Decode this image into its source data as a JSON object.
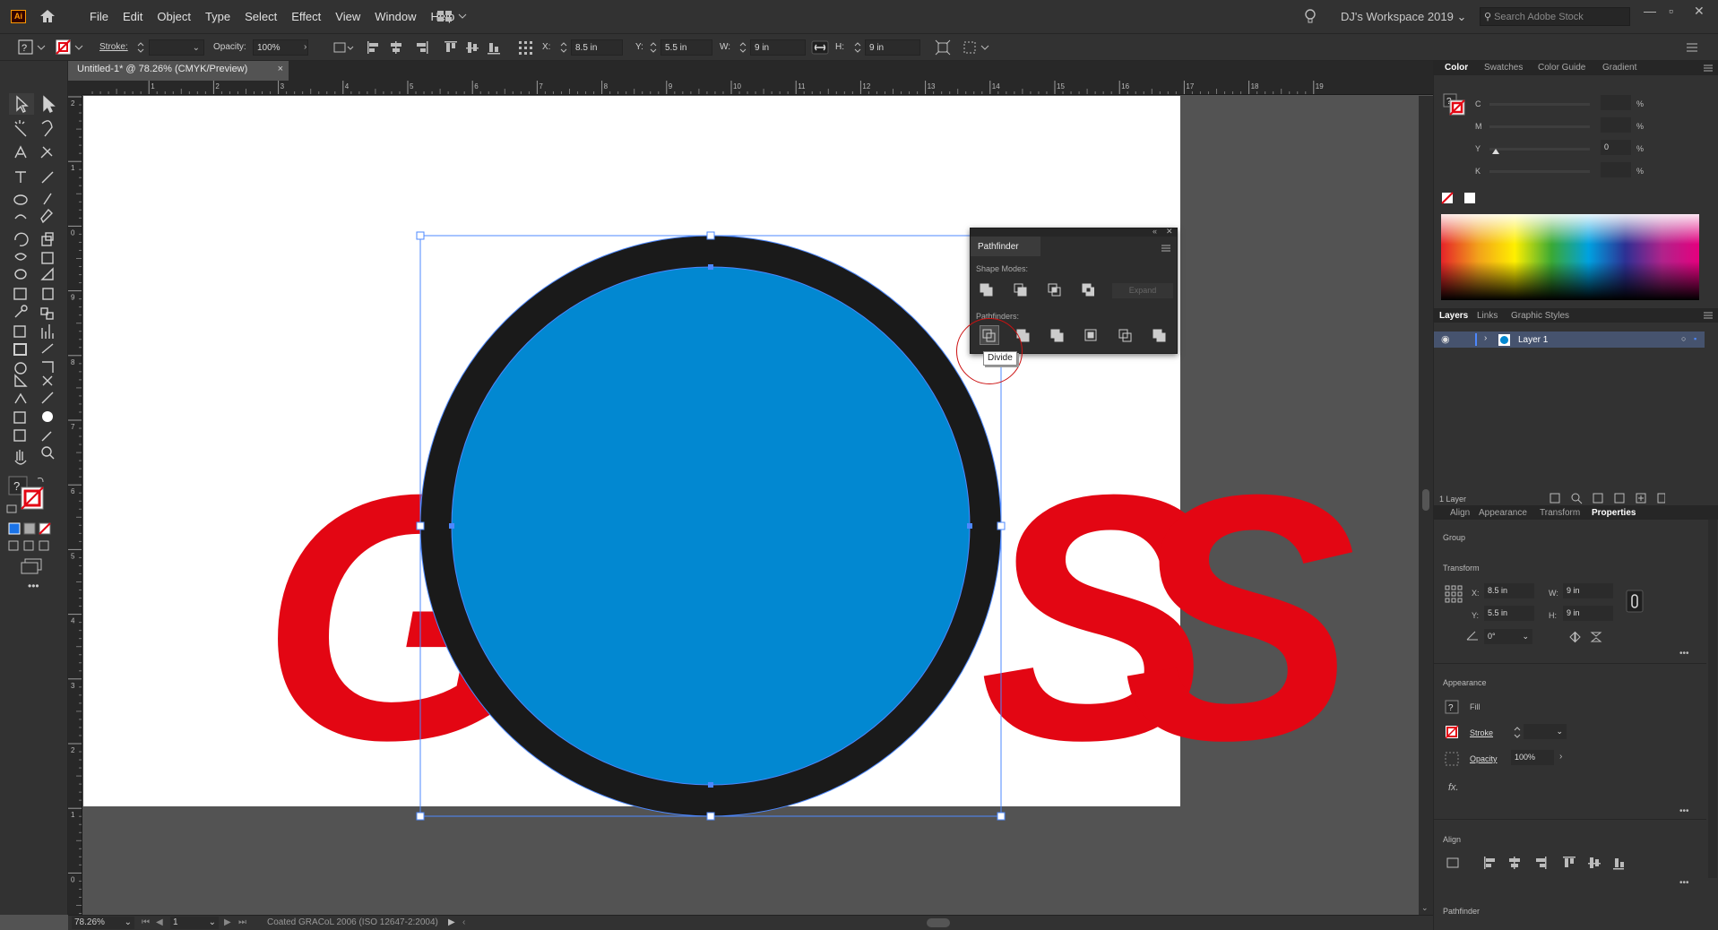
{
  "app": {
    "logo": "Ai",
    "menus": [
      "File",
      "Edit",
      "Object",
      "Type",
      "Select",
      "Effect",
      "View",
      "Window",
      "Help"
    ],
    "workspace": "DJ's Workspace 2019",
    "search_placeholder": "Search Adobe Stock"
  },
  "control_bar": {
    "stroke_label": "Stroke:",
    "opacity_label": "Opacity:",
    "opacity_value": "100%",
    "x_label": "X:",
    "x_value": "8.5 in",
    "y_label": "Y:",
    "y_value": "5.5 in",
    "w_label": "W:",
    "w_value": "9 in",
    "h_label": "H:",
    "h_value": "9 in"
  },
  "document": {
    "tab_title": "Untitled-1* @ 78.26% (CMYK/Preview)",
    "close": "×"
  },
  "rulers": {
    "h_ticks": [
      "1",
      "2",
      "3",
      "4",
      "5",
      "6",
      "7",
      "8",
      "9",
      "10",
      "11",
      "12",
      "13",
      "14",
      "15",
      "16",
      "17",
      "18",
      "19"
    ],
    "v_ticks": [
      "2",
      "1",
      "0",
      "9",
      "8",
      "7",
      "6",
      "5",
      "4",
      "3",
      "2",
      "1",
      "0"
    ]
  },
  "artwork": {
    "letters": [
      "G",
      "O",
      "S",
      "S"
    ],
    "circle_fill": "#0288d1",
    "circle_stroke": "#1a1a1a",
    "text_color": "#e30613",
    "selection_color": "#4d88ff"
  },
  "pathfinder": {
    "title": "Pathfinder",
    "shape_modes_label": "Shape Modes:",
    "pathfinders_label": "Pathfinders:",
    "expand_label": "Expand",
    "tooltip": "Divide",
    "highlight_color": "#cc1111"
  },
  "status_bar": {
    "zoom": "78.26%",
    "artboard": "1",
    "profile": "Coated GRACoL 2006 (ISO 12647-2:2004)"
  },
  "color_panel": {
    "tabs": [
      "Color",
      "Swatches",
      "Color Guide",
      "Gradient"
    ],
    "active": "Color",
    "channels": [
      {
        "name": "C",
        "value": "",
        "unit": "%"
      },
      {
        "name": "M",
        "value": "",
        "unit": "%"
      },
      {
        "name": "Y",
        "value": "0",
        "unit": "%"
      },
      {
        "name": "K",
        "value": "",
        "unit": "%"
      }
    ]
  },
  "layers_panel": {
    "tabs": [
      "Layers",
      "Links",
      "Graphic Styles"
    ],
    "layer_name": "Layer 1",
    "footer": "1 Layer"
  },
  "properties_panel": {
    "tabs": [
      "Align",
      "Appearance",
      "Transform",
      "Properties"
    ],
    "active": "Properties",
    "selection_type": "Group",
    "transform_label": "Transform",
    "x_label": "X:",
    "x": "8.5 in",
    "y_label": "Y:",
    "y": "5.5 in",
    "w_label": "W:",
    "w": "9 in",
    "h_label": "H:",
    "h": "9 in",
    "angle": "0°",
    "appearance_label": "Appearance",
    "fill_label": "Fill",
    "stroke_label": "Stroke",
    "opacity_label": "Opacity",
    "opacity_value": "100%",
    "fx_label": "fx.",
    "align_label": "Align",
    "pathfinder_label": "Pathfinder",
    "more": "•••"
  }
}
